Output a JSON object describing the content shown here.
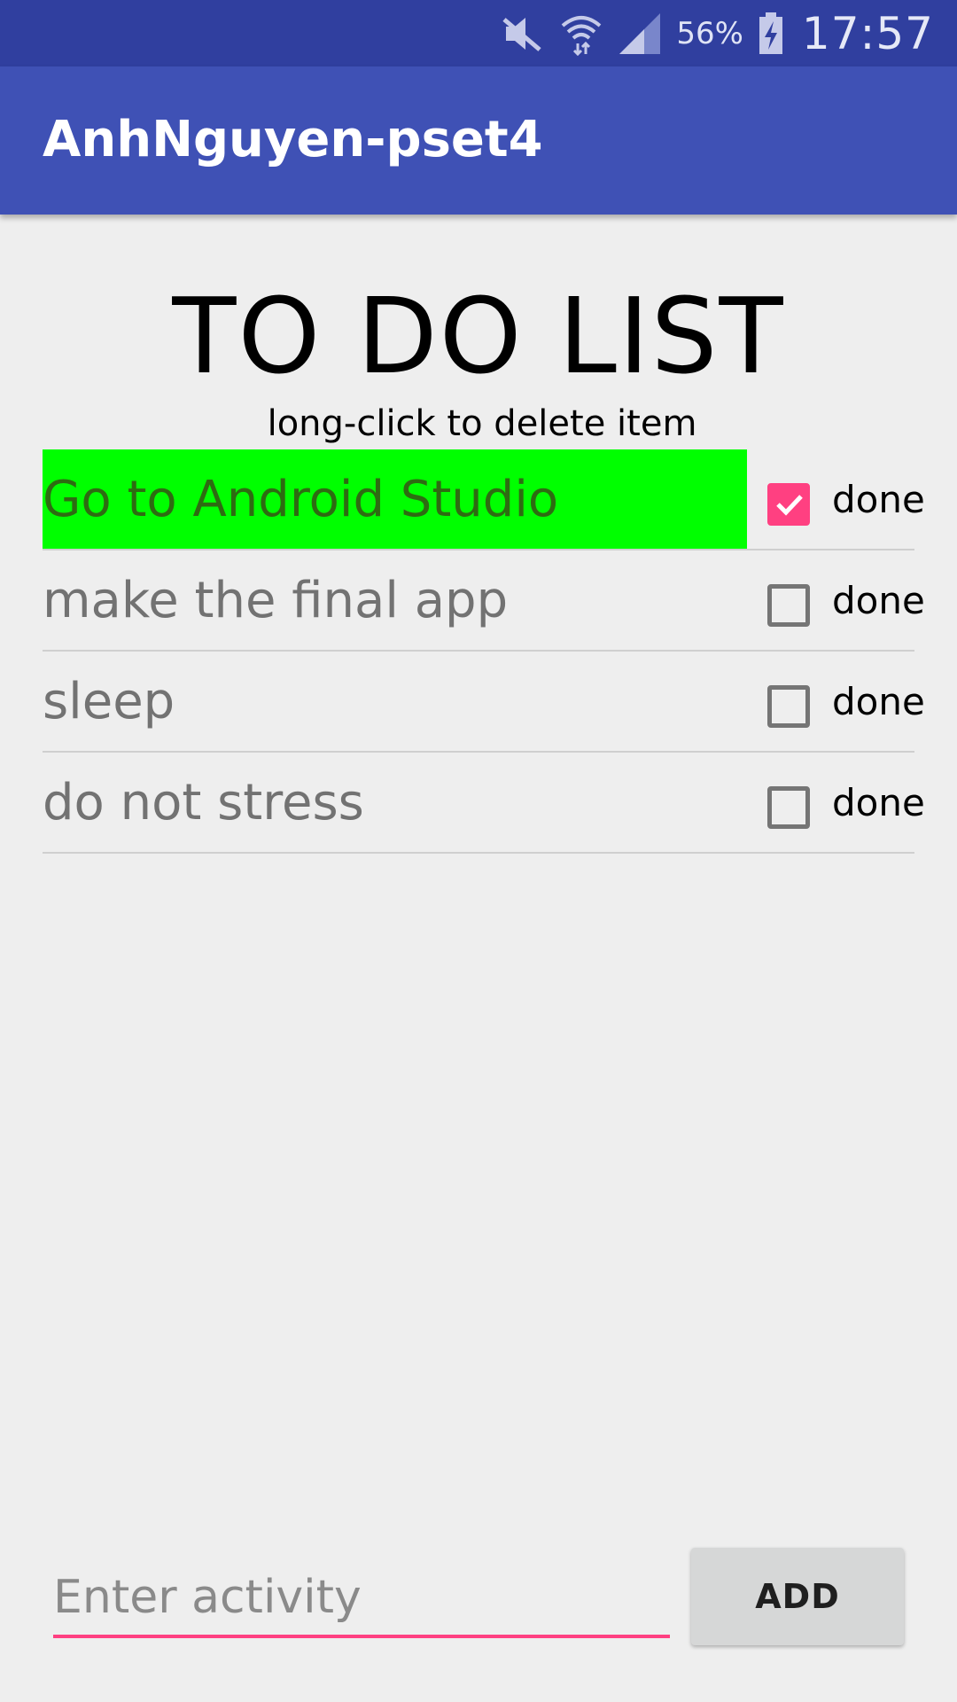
{
  "status_bar": {
    "battery_percent": "56%",
    "time": "17:57",
    "icons": [
      "mute-icon",
      "wifi-icon",
      "signal-icon",
      "battery-charging-icon"
    ],
    "background": "#303f9f"
  },
  "app_bar": {
    "title": "AnhNguyen-pset4",
    "background": "#3f51b5"
  },
  "main": {
    "heading": "TO DO LIST",
    "hint": "long-click to delete item"
  },
  "todo_items": [
    {
      "text": "Go to Android Studio",
      "done_label": "done",
      "checked": true,
      "highlighted": true
    },
    {
      "text": "make the final app",
      "done_label": "done",
      "checked": false,
      "highlighted": false
    },
    {
      "text": "sleep",
      "done_label": "done",
      "checked": false,
      "highlighted": false
    },
    {
      "text": "do not stress",
      "done_label": "done",
      "checked": false,
      "highlighted": false
    }
  ],
  "add_form": {
    "input_value": "",
    "input_placeholder": "Enter activity",
    "add_label": "ADD"
  },
  "colors": {
    "accent": "#ff4081",
    "highlight": "#00ff00"
  }
}
